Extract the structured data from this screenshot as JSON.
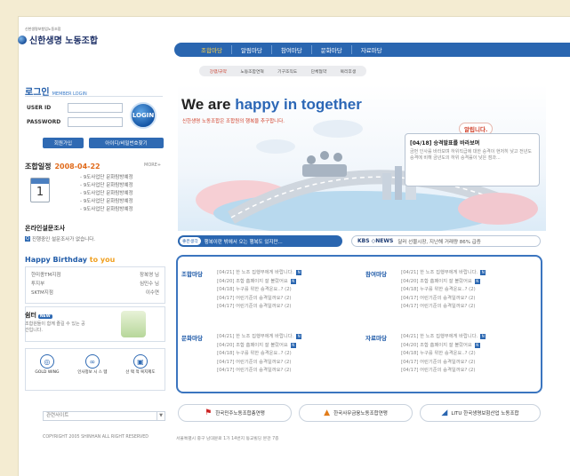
{
  "logo": {
    "sub": "신한생명보험업노동조합",
    "title": "신한생명 노동조합"
  },
  "login": {
    "title": "로그인",
    "title_en": "MEMBER LOGIN",
    "userid_label": "USER ID",
    "password_label": "PASSWORD",
    "button": "LOGIN",
    "join": "회원가입",
    "find": "아이디/비밀번호찾기"
  },
  "schedule": {
    "title": "조합일정",
    "date": "2008-04-22",
    "more": "MORE+",
    "items": [
      "- 9도사업단 문화탐방예정",
      "- 9도사업단 문화탐방예정",
      "- 9도사업단 문화탐방예정",
      "- 9도사업단 문화탐방예정",
      "- 9도사업단 문화탐방예정"
    ],
    "calendar_day": "1"
  },
  "survey": {
    "title": "온라인설문조사",
    "icon": "Q",
    "item": "진행중인 설문조사가 없습니다."
  },
  "birthday": {
    "title_a": "Happy Birthday",
    "title_b": "to you",
    "rows": [
      {
        "l": "한미종TM지점",
        "r": "장복영 님"
      },
      {
        "l": "투지부",
        "r": "심민수 님"
      },
      {
        "l": "SKTM지점",
        "r": "이수연"
      }
    ]
  },
  "rest": {
    "title": "쉼터",
    "badge": "NEW",
    "desc": "조합원들이 함께 즐길 수 있는 공간입니다."
  },
  "quick": [
    {
      "icon": "globe-icon",
      "glyph": "◎",
      "label": "GOLD WING"
    },
    {
      "icon": "people-icon",
      "glyph": "∞",
      "label": "인사정보 시 스 템"
    },
    {
      "icon": "doc-icon",
      "glyph": "▣",
      "label": "선 택 적 복지제도"
    }
  ],
  "related": {
    "label": "관련사이트",
    "arrow": "▼"
  },
  "copyright": "COPYRIGHT 2005 SHINHAN ALL RIGHT RESERVED",
  "address": "서울특별시 중구 남대문로 1가 14번지 동교빌딩 본관 7층",
  "gnb": [
    "조합마당",
    "알림마당",
    "참여마당",
    "문화마당",
    "자료마당"
  ],
  "lnb": [
    "강령/규약",
    "노동조합연혁",
    "기구조직도",
    "단체협약",
    "복리후생"
  ],
  "hero": {
    "h1_a": "We are",
    "h1_b": "happy in together",
    "sub": "신한생명 노동조합은 조합원의 행복을 추구합니다.",
    "tag": "알립니다.",
    "notice_title": "[04/18] 승격발표를 바라보며",
    "notice_body": "금번 인사를 바라보며 하위직급에 대한 승격이 현저히 낮고 전년도 승격에 비해 금년도의 하위 승격률이 낮은 점과..."
  },
  "ticker": {
    "badge": "좋은생각",
    "text": "행복이란 밖에서 오는 행복도 있지만..."
  },
  "kbs": {
    "badge": "KBS ◇NEWS",
    "text": "달러 선물시장, 지난해 거래량 86% 급증"
  },
  "boards": [
    {
      "title": "조합마당",
      "items": [
        "[04/21] 한 노조 집행부에게 바랍니다.",
        "[04/20] 조합 홈페이지 잘 볼랐어요",
        "[04/18] 누구를 위한 승격운요..? (2)",
        "[04/17] 어린기준의 승격일까요? (2)",
        "[04/17] 어린기준의 승격일까요? (2)"
      ]
    },
    {
      "title": "참여마당",
      "items": [
        "[04/21] 한 노조 집행부에게 바랍니다.",
        "[04/20] 조합 홈페이지 잘 볼랐어요",
        "[04/18] 누구를 위한 승격운요..? (2)",
        "[04/17] 어린기준의 승격일까요? (2)",
        "[04/17] 어린기준의 승격일까요? (2)"
      ]
    },
    {
      "title": "문화마당",
      "items": [
        "[04/21] 한 노조 집행부에게 바랍니다.",
        "[04/20] 조합 홈페이지 잘 볼랐어요",
        "[04/18] 누구를 위한 승격운요..? (2)",
        "[04/17] 어린기준의 승격일까요? (2)",
        "[04/17] 어린기준의 승격일까요? (2)"
      ]
    },
    {
      "title": "자료마당",
      "items": [
        "[04/21] 한 노조 집행부에게 바랍니다.",
        "[04/20] 조합 홈페이지 잘 볼랐어요",
        "[04/18] 누구를 위한 승격운요..? (2)",
        "[04/17] 어린기준의 승격일까요? (2)",
        "[04/17] 어린기준의 승격일까요? (2)"
      ]
    }
  ],
  "partners": [
    {
      "icon": "flag-icon",
      "glyph": "⚑",
      "label": "한국민주노동조합총연맹"
    },
    {
      "icon": "mountain-icon",
      "glyph": "▲",
      "label": "한국사무금융노동조합연맹"
    },
    {
      "icon": "litu-icon",
      "glyph": "◢",
      "label": "LITU 한국생명보험산업 노동조합"
    }
  ],
  "new_icon": "N"
}
